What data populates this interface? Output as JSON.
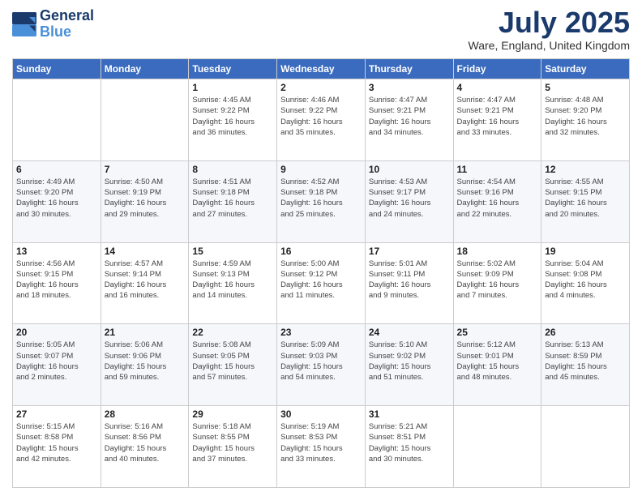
{
  "header": {
    "logo_line1": "General",
    "logo_line2": "Blue",
    "month": "July 2025",
    "location": "Ware, England, United Kingdom"
  },
  "weekdays": [
    "Sunday",
    "Monday",
    "Tuesday",
    "Wednesday",
    "Thursday",
    "Friday",
    "Saturday"
  ],
  "weeks": [
    [
      {
        "day": "",
        "info": ""
      },
      {
        "day": "",
        "info": ""
      },
      {
        "day": "1",
        "info": "Sunrise: 4:45 AM\nSunset: 9:22 PM\nDaylight: 16 hours\nand 36 minutes."
      },
      {
        "day": "2",
        "info": "Sunrise: 4:46 AM\nSunset: 9:22 PM\nDaylight: 16 hours\nand 35 minutes."
      },
      {
        "day": "3",
        "info": "Sunrise: 4:47 AM\nSunset: 9:21 PM\nDaylight: 16 hours\nand 34 minutes."
      },
      {
        "day": "4",
        "info": "Sunrise: 4:47 AM\nSunset: 9:21 PM\nDaylight: 16 hours\nand 33 minutes."
      },
      {
        "day": "5",
        "info": "Sunrise: 4:48 AM\nSunset: 9:20 PM\nDaylight: 16 hours\nand 32 minutes."
      }
    ],
    [
      {
        "day": "6",
        "info": "Sunrise: 4:49 AM\nSunset: 9:20 PM\nDaylight: 16 hours\nand 30 minutes."
      },
      {
        "day": "7",
        "info": "Sunrise: 4:50 AM\nSunset: 9:19 PM\nDaylight: 16 hours\nand 29 minutes."
      },
      {
        "day": "8",
        "info": "Sunrise: 4:51 AM\nSunset: 9:18 PM\nDaylight: 16 hours\nand 27 minutes."
      },
      {
        "day": "9",
        "info": "Sunrise: 4:52 AM\nSunset: 9:18 PM\nDaylight: 16 hours\nand 25 minutes."
      },
      {
        "day": "10",
        "info": "Sunrise: 4:53 AM\nSunset: 9:17 PM\nDaylight: 16 hours\nand 24 minutes."
      },
      {
        "day": "11",
        "info": "Sunrise: 4:54 AM\nSunset: 9:16 PM\nDaylight: 16 hours\nand 22 minutes."
      },
      {
        "day": "12",
        "info": "Sunrise: 4:55 AM\nSunset: 9:15 PM\nDaylight: 16 hours\nand 20 minutes."
      }
    ],
    [
      {
        "day": "13",
        "info": "Sunrise: 4:56 AM\nSunset: 9:15 PM\nDaylight: 16 hours\nand 18 minutes."
      },
      {
        "day": "14",
        "info": "Sunrise: 4:57 AM\nSunset: 9:14 PM\nDaylight: 16 hours\nand 16 minutes."
      },
      {
        "day": "15",
        "info": "Sunrise: 4:59 AM\nSunset: 9:13 PM\nDaylight: 16 hours\nand 14 minutes."
      },
      {
        "day": "16",
        "info": "Sunrise: 5:00 AM\nSunset: 9:12 PM\nDaylight: 16 hours\nand 11 minutes."
      },
      {
        "day": "17",
        "info": "Sunrise: 5:01 AM\nSunset: 9:11 PM\nDaylight: 16 hours\nand 9 minutes."
      },
      {
        "day": "18",
        "info": "Sunrise: 5:02 AM\nSunset: 9:09 PM\nDaylight: 16 hours\nand 7 minutes."
      },
      {
        "day": "19",
        "info": "Sunrise: 5:04 AM\nSunset: 9:08 PM\nDaylight: 16 hours\nand 4 minutes."
      }
    ],
    [
      {
        "day": "20",
        "info": "Sunrise: 5:05 AM\nSunset: 9:07 PM\nDaylight: 16 hours\nand 2 minutes."
      },
      {
        "day": "21",
        "info": "Sunrise: 5:06 AM\nSunset: 9:06 PM\nDaylight: 15 hours\nand 59 minutes."
      },
      {
        "day": "22",
        "info": "Sunrise: 5:08 AM\nSunset: 9:05 PM\nDaylight: 15 hours\nand 57 minutes."
      },
      {
        "day": "23",
        "info": "Sunrise: 5:09 AM\nSunset: 9:03 PM\nDaylight: 15 hours\nand 54 minutes."
      },
      {
        "day": "24",
        "info": "Sunrise: 5:10 AM\nSunset: 9:02 PM\nDaylight: 15 hours\nand 51 minutes."
      },
      {
        "day": "25",
        "info": "Sunrise: 5:12 AM\nSunset: 9:01 PM\nDaylight: 15 hours\nand 48 minutes."
      },
      {
        "day": "26",
        "info": "Sunrise: 5:13 AM\nSunset: 8:59 PM\nDaylight: 15 hours\nand 45 minutes."
      }
    ],
    [
      {
        "day": "27",
        "info": "Sunrise: 5:15 AM\nSunset: 8:58 PM\nDaylight: 15 hours\nand 42 minutes."
      },
      {
        "day": "28",
        "info": "Sunrise: 5:16 AM\nSunset: 8:56 PM\nDaylight: 15 hours\nand 40 minutes."
      },
      {
        "day": "29",
        "info": "Sunrise: 5:18 AM\nSunset: 8:55 PM\nDaylight: 15 hours\nand 37 minutes."
      },
      {
        "day": "30",
        "info": "Sunrise: 5:19 AM\nSunset: 8:53 PM\nDaylight: 15 hours\nand 33 minutes."
      },
      {
        "day": "31",
        "info": "Sunrise: 5:21 AM\nSunset: 8:51 PM\nDaylight: 15 hours\nand 30 minutes."
      },
      {
        "day": "",
        "info": ""
      },
      {
        "day": "",
        "info": ""
      }
    ]
  ]
}
